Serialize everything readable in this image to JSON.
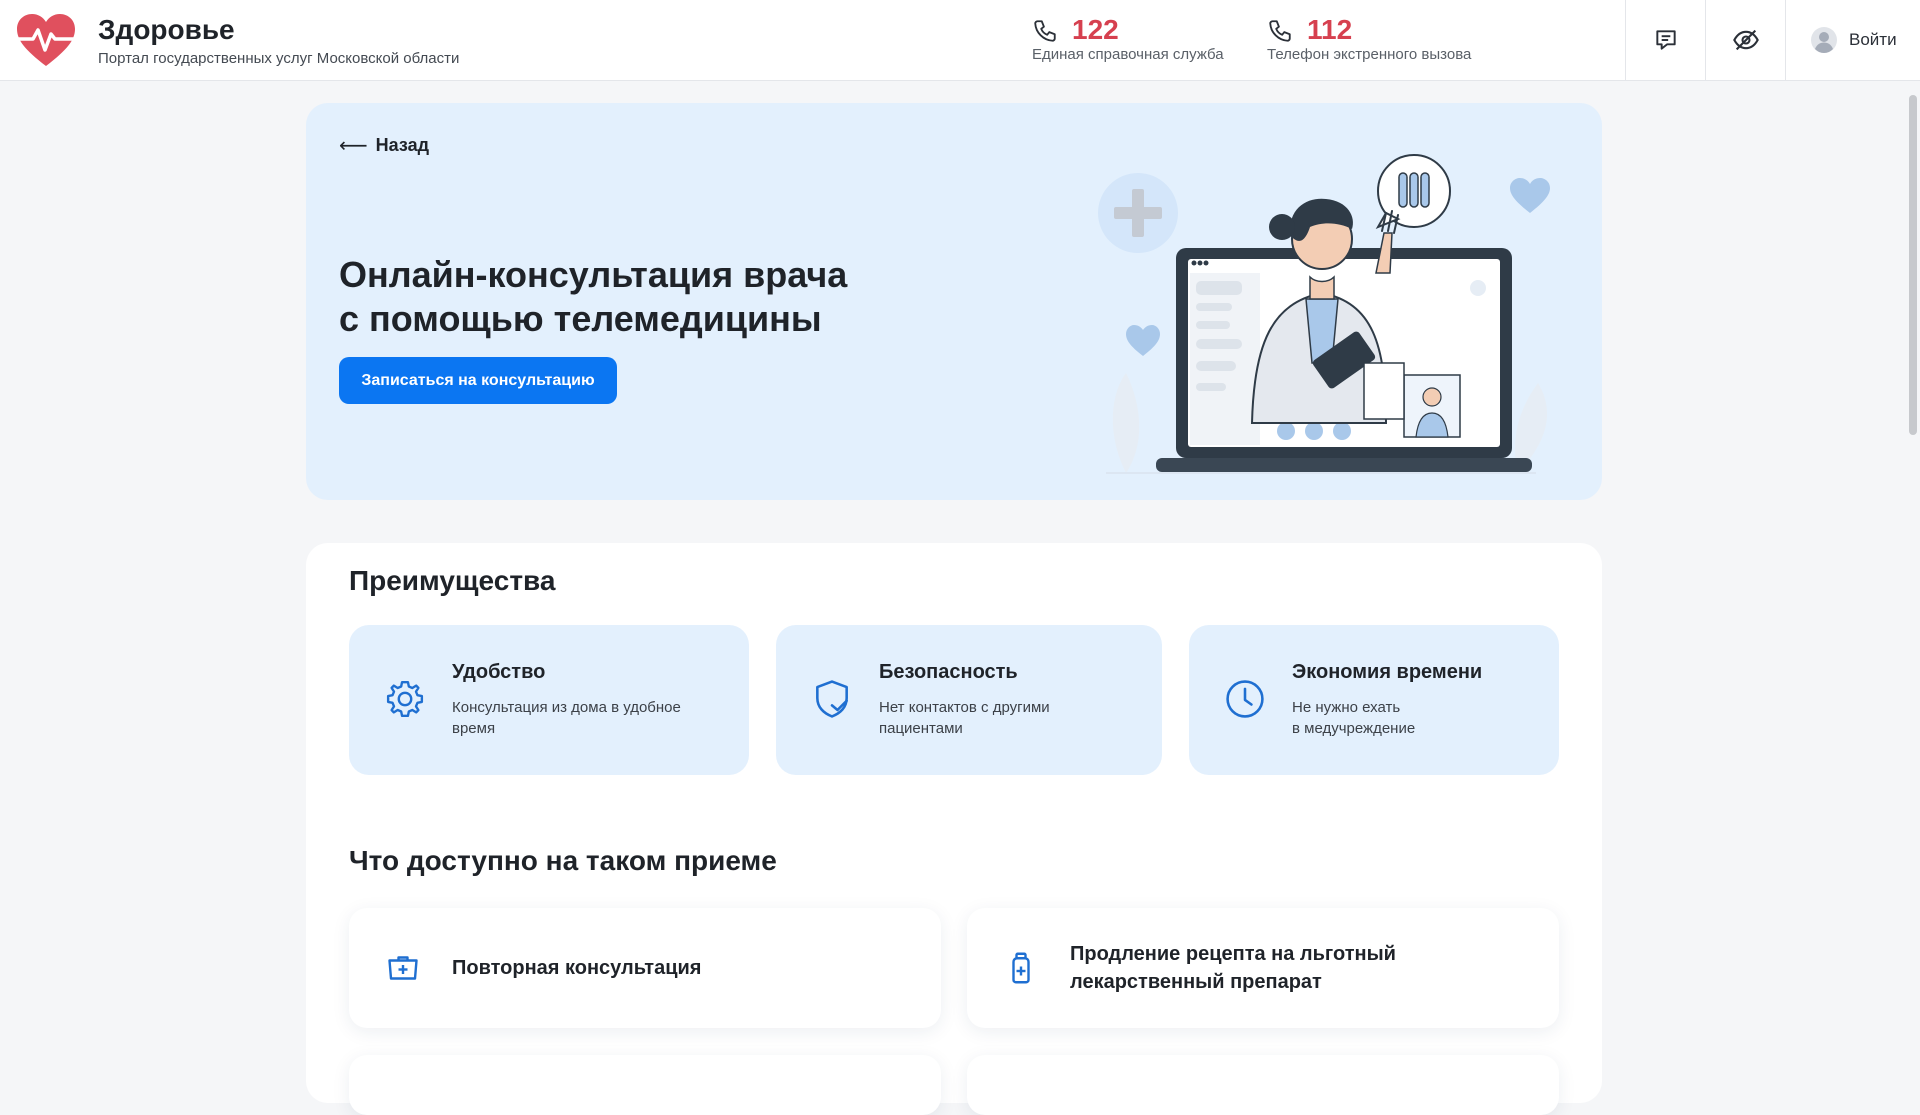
{
  "header": {
    "brand_title": "Здоровье",
    "brand_subtitle": "Портал государственных услуг Московской области",
    "phones": [
      {
        "number": "122",
        "label": "Единая справочная служба",
        "icon": "phone-icon"
      },
      {
        "number": "112",
        "label": "Телефон экстренного вызова",
        "icon": "phone-icon"
      }
    ],
    "login_label": "Войти",
    "icons": [
      "heart-pulse-logo-icon",
      "chat-icon",
      "eye-off-icon",
      "user-avatar-icon"
    ]
  },
  "hero": {
    "back_label": "Назад",
    "title_line1": "Онлайн-консультация врача",
    "title_line2": "с помощью телемедицины",
    "cta_label": "Записаться на консультацию"
  },
  "advantages": {
    "title": "Преимущества",
    "items": [
      {
        "title": "Удобство",
        "line1": "Консультация из дома в удобное",
        "line2": "время",
        "icon": "gear-icon"
      },
      {
        "title": "Безопасность",
        "line1": "Нет контактов с другими",
        "line2": "пациентами",
        "icon": "shield-check-icon"
      },
      {
        "title": "Экономия времени",
        "line1": "Не нужно ехать",
        "line2": "в медучреждение",
        "icon": "clock-icon"
      }
    ]
  },
  "available": {
    "title": "Что доступно на таком приеме",
    "items": [
      {
        "line1": "Повторная консультация",
        "line2": "",
        "icon": "medical-case-icon"
      },
      {
        "line1": "Продление рецепта на льготный",
        "line2": "лекарственный препарат",
        "icon": "medicine-bottle-icon"
      }
    ]
  },
  "colors": {
    "accent": "#0b76f2",
    "phone_number": "#d6404f",
    "card_bg": "#e3f0fd",
    "logo": "#e0505e",
    "icon_blue": "#1f6fd1"
  }
}
